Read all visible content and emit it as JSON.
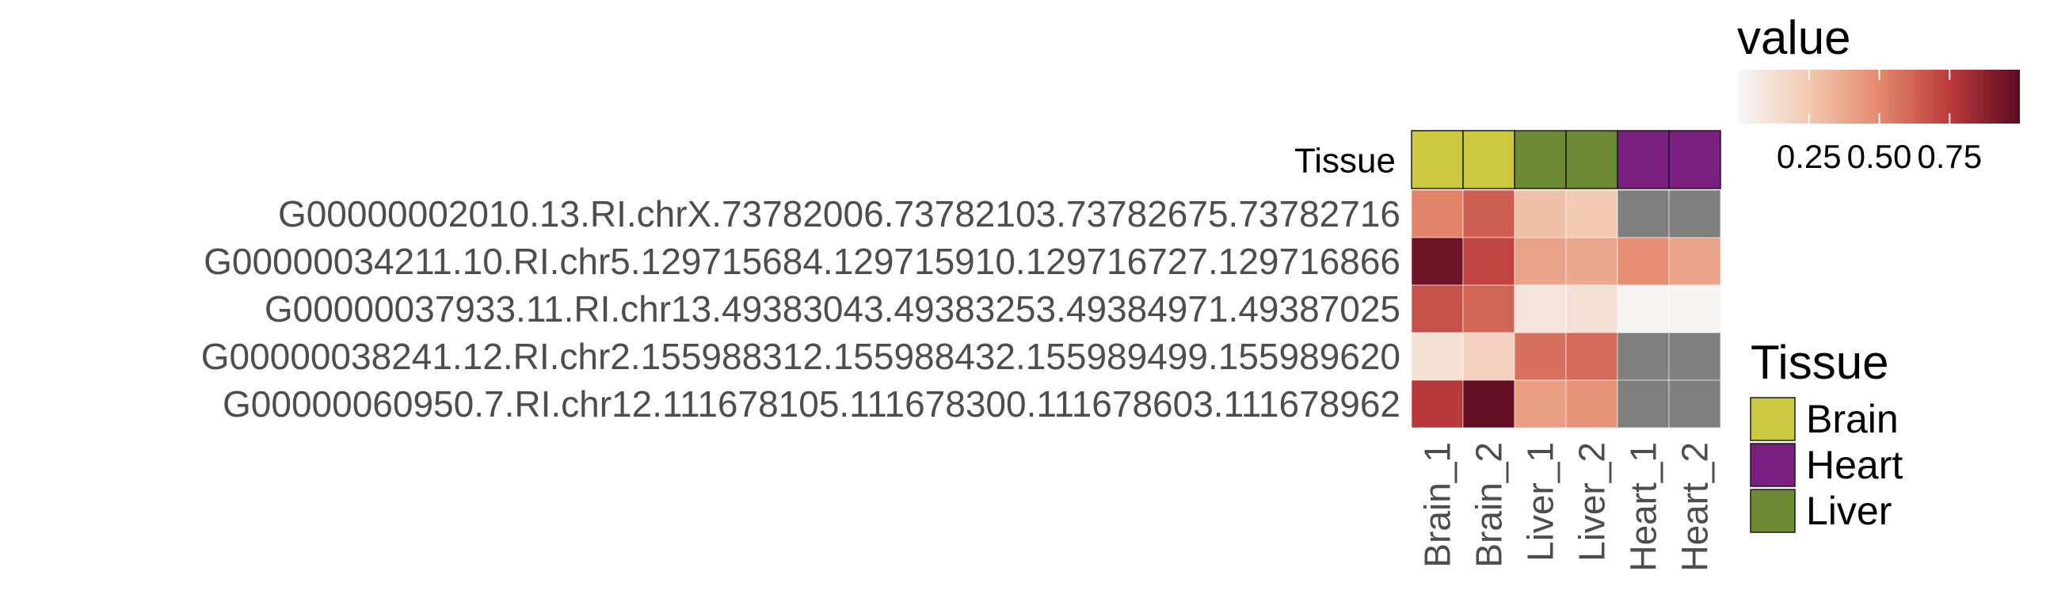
{
  "chart_data": {
    "type": "heatmap",
    "columns": [
      "Brain_1",
      "Brain_2",
      "Liver_1",
      "Liver_2",
      "Heart_1",
      "Heart_2"
    ],
    "rows": [
      "G00000002010.13.RI.chrX.73782006.73782103.73782675.73782716",
      "G00000034211.10.RI.chr5.129715684.129715910.129716727.129716866",
      "G00000037933.11.RI.chr13.49383043.49383253.49384971.49387025",
      "G00000038241.12.RI.chr2.155988312.155988432.155989499.155989620",
      "G00000060950.7.RI.chr12.111678105.111678300.111678603.111678962"
    ],
    "values": [
      [
        0.52,
        0.64,
        0.28,
        0.24,
        null,
        null
      ],
      [
        0.95,
        0.72,
        0.4,
        0.38,
        0.48,
        0.4
      ],
      [
        0.68,
        0.62,
        0.1,
        0.12,
        0.02,
        0.02
      ],
      [
        0.12,
        0.2,
        0.58,
        0.6,
        null,
        null
      ],
      [
        0.76,
        0.98,
        0.42,
        0.46,
        null,
        null
      ]
    ],
    "missing_color": "#7f7f7f",
    "annotation": {
      "label": "Tissue",
      "values": [
        "Brain",
        "Brain",
        "Liver",
        "Liver",
        "Heart",
        "Heart"
      ],
      "colors": {
        "Brain": "#cdc93e",
        "Heart": "#7a1f80",
        "Liver": "#6b8a33"
      }
    },
    "colorbar": {
      "title": "value",
      "range": [
        0,
        1
      ],
      "ticks": [
        0.25,
        0.5,
        0.75
      ],
      "tick_labels": [
        "0.25",
        "0.50",
        "0.75"
      ],
      "colors": [
        "#f7f7f7",
        "#f3c8b0",
        "#e4896d",
        "#bb3b3b",
        "#5c0a22"
      ]
    },
    "legend": {
      "title": "Tissue",
      "items": [
        {
          "label": "Brain",
          "color": "#cdc93e"
        },
        {
          "label": "Heart",
          "color": "#7a1f80"
        },
        {
          "label": "Liver",
          "color": "#6b8a33"
        }
      ]
    }
  }
}
